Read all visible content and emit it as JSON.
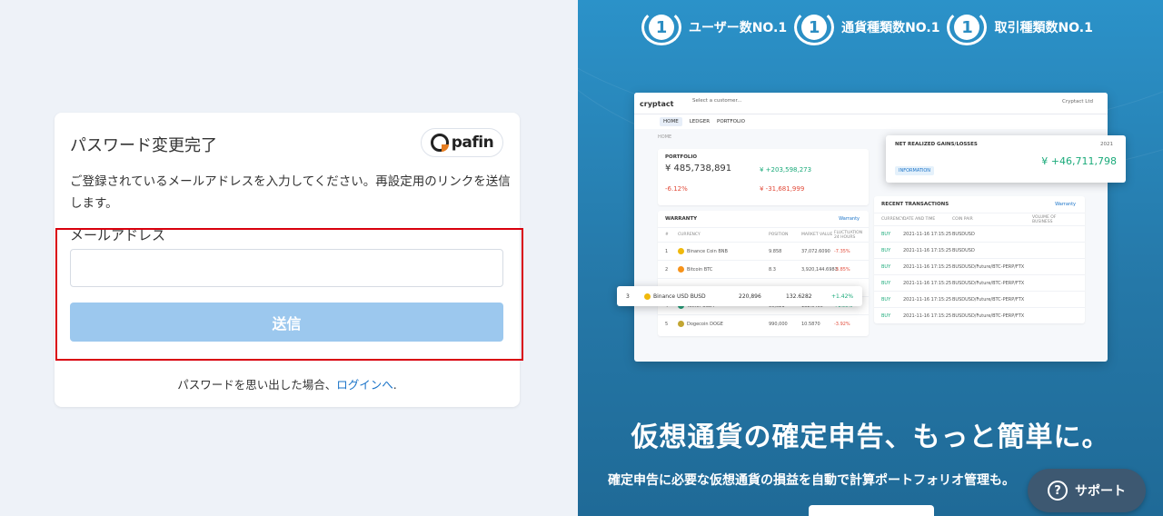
{
  "form": {
    "title": "パスワード変更完了",
    "logo_text": "pafin",
    "description": "ご登録されているメールアドレスを入力してください。再設定用のリンクを送信します。",
    "email_label": "メールアドレス",
    "email_value": "",
    "email_placeholder": "",
    "submit_label": "送信",
    "footer_text": "パスワードを思い出した場合、",
    "footer_link": "ログインへ",
    "footer_suffix": "."
  },
  "promo": {
    "awards": [
      {
        "rank": "1",
        "label": "ユーザー数NO.1"
      },
      {
        "rank": "1",
        "label": "通貨種類数NO.1"
      },
      {
        "rank": "1",
        "label": "取引種類数NO.1"
      }
    ],
    "headline": "仮想通貨の確定申告、もっと簡単に。",
    "subline": "確定申告に必要な仮想通貨の損益を自動で計算ポートフォリオ管理も。",
    "support_label": "サポート"
  },
  "mock": {
    "brand": "cryptact",
    "customer_label": "Select a customer...",
    "user": "Cryptact Ltd",
    "nav": [
      "HOME",
      "LEDGER",
      "PORTFOLIO"
    ],
    "breadcrumb": "HOME",
    "portfolio": {
      "title": "PORTFOLIO",
      "value": "¥ 485,738,891",
      "gain": "¥ +203,598,273",
      "pct": "-6.12%",
      "loss": "¥ -31,681,999"
    },
    "warranty": {
      "title": "WARRANTY",
      "link": "Warranty",
      "headers": [
        "#",
        "CURRENCY",
        "POSITION",
        "MARKET VALUE",
        "FLUCTUATION 24 HOURS"
      ],
      "rows": [
        {
          "n": "1",
          "name": "Binance Coin BNB",
          "pos": "9.858",
          "mv": "37,072.6090",
          "fl": "-7.35%"
        },
        {
          "n": "2",
          "name": "Bitcoin BTC",
          "pos": "8.3",
          "mv": "3,920,144.6983",
          "fl": "-3.85%"
        },
        {
          "n": "4",
          "name": "Tether USDT",
          "pos": "90,021",
          "mv": "132.6400",
          "fl": "+1.56%"
        },
        {
          "n": "5",
          "name": "Dogecoin DOGE",
          "pos": "990,000",
          "mv": "10.5870",
          "fl": "-3.92%"
        }
      ],
      "highlight_row": {
        "n": "3",
        "name": "Binance USD BUSD",
        "pos": "220,896",
        "mv": "132.6282",
        "fl": "+1.42%"
      }
    },
    "gains": {
      "title": "NET REALIZED GAINS/LOSSES",
      "year": "2021",
      "tag": "INFORMATION",
      "value": "¥ +46,711,798"
    },
    "transactions": {
      "title": "RECENT TRANSACTIONS",
      "link": "Warranty",
      "headers": [
        "CURRENCY",
        "DATE AND TIME",
        "COIN PAIR",
        "VOLUME OF BUSINESS"
      ],
      "rows": [
        {
          "type": "BUY",
          "date": "2021-11-16 17:15:25",
          "pair": "BUSDUSD"
        },
        {
          "type": "BUY",
          "date": "2021-11-16 17:15:25",
          "pair": "BUSDUSD"
        },
        {
          "type": "BUY",
          "date": "2021-11-16 17:15:25",
          "pair": "BUSDUSD/Future/BTC-PERP/FTX"
        },
        {
          "type": "BUY",
          "date": "2021-11-16 17:15:25",
          "pair": "BUSDUSD/Future/BTC-PERP/FTX"
        },
        {
          "type": "BUY",
          "date": "2021-11-16 17:15:25",
          "pair": "BUSDUSD/Future/BTC-PERP/FTX"
        },
        {
          "type": "BUY",
          "date": "2021-11-16 17:15:25",
          "pair": "BUSDUSD/Future/BTC-PERP/FTX"
        }
      ]
    }
  },
  "colors": {
    "accent": "#1a73c8",
    "button_disabled": "#9cc8ee",
    "highlight_border": "#d9000d",
    "promo_bg": "#2b92c9",
    "support_bg": "#3d5871"
  }
}
